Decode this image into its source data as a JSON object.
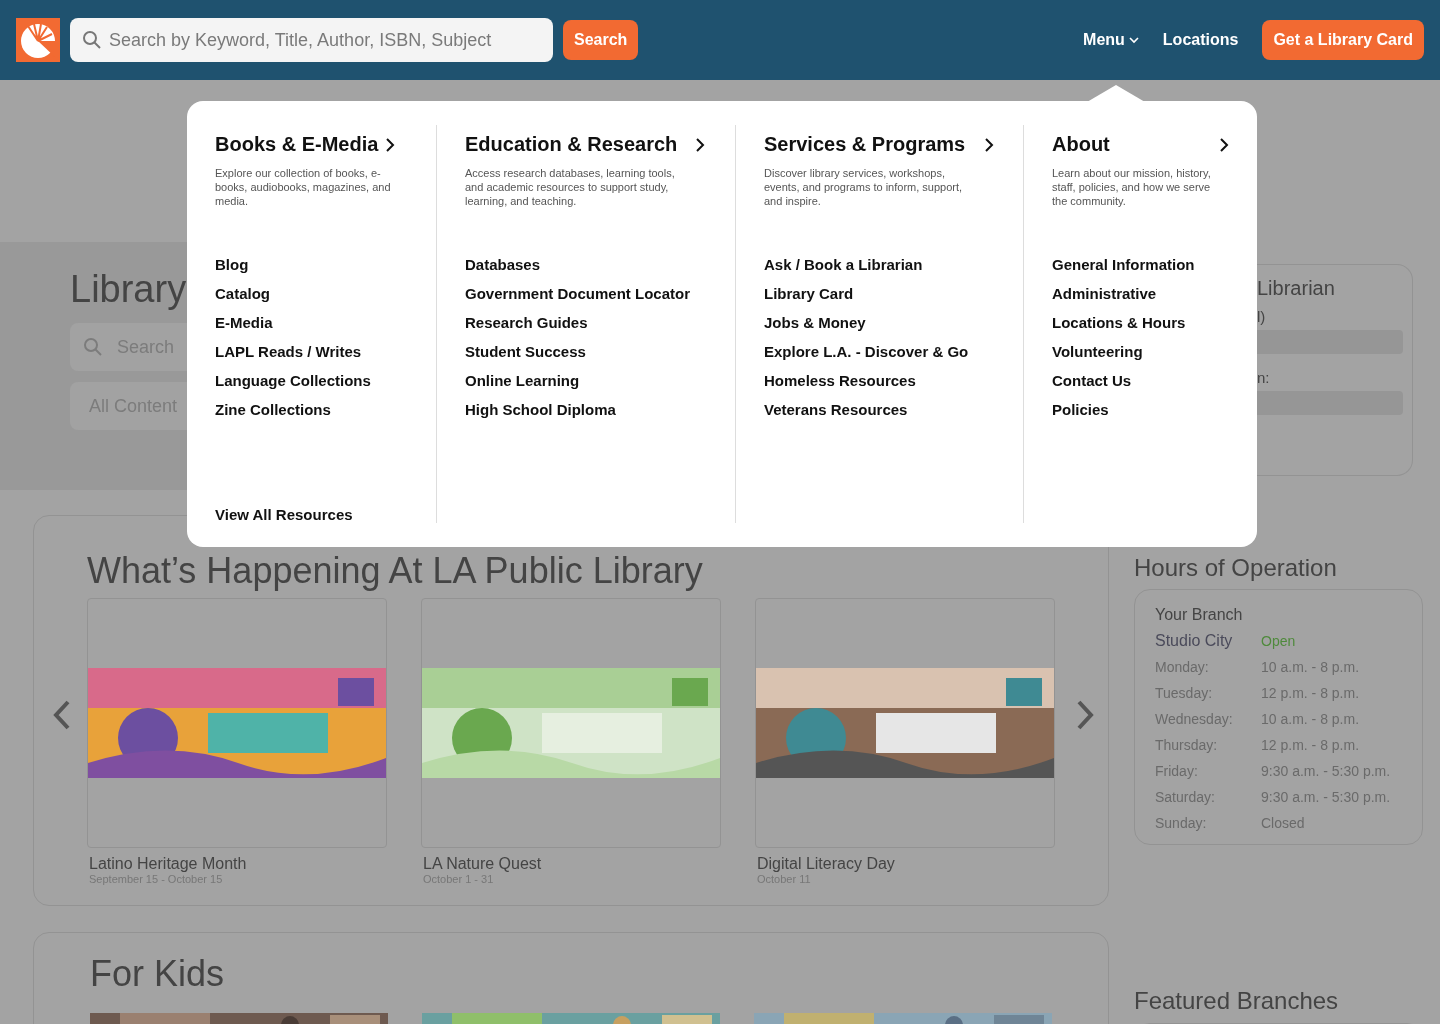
{
  "header": {
    "search": {
      "placeholder": "Search by Keyword, Title, Author, ISBN, Subject"
    },
    "search_button": "Search",
    "nav": [
      {
        "label": "Menu",
        "kind": "dropdown"
      },
      {
        "label": "Locations",
        "kind": "link"
      }
    ],
    "cta": "Get a Library Card"
  },
  "mega_menu": {
    "columns": [
      {
        "title": "Books & E-Media",
        "description": "Explore our collection of books, e-books, audiobooks, magazines, and media.",
        "links": [
          "Blog",
          "Catalog",
          "E-Media",
          "LAPL Reads / Writes",
          "Language Collections",
          "Zine Collections"
        ],
        "footer_link": "View All Resources"
      },
      {
        "title": "Education & Research",
        "description": "Access research databases, learning tools, and academic resources to support study, learning, and teaching.",
        "links": [
          "Databases",
          "Government Document Locator",
          "Research Guides",
          "Student Success",
          "Online Learning",
          "High School Diploma"
        ]
      },
      {
        "title": "Services & Programs",
        "description": "Discover library services, workshops, events, and programs to inform, support, and inspire.",
        "links": [
          "Ask / Book a Librarian",
          "Library Card",
          "Jobs & Money",
          "Explore L.A. - Discover & Go",
          "Homeless Resources",
          "Veterans Resources"
        ]
      },
      {
        "title": "About",
        "description": "Learn about our mission, history, staff, policies, and how we serve the community.",
        "links": [
          "General Information",
          "Administrative",
          "Locations & Hours",
          "Volunteering",
          "Contact Us",
          "Policies"
        ]
      }
    ]
  },
  "hero": {
    "title": "Library",
    "search_placeholder": "Search",
    "filter": "All Content"
  },
  "ask_card": {
    "title": "Librarian",
    "field_1_label": "l)",
    "field_2_label": "n:"
  },
  "events": {
    "title": "What’s Happening At LA Public Library",
    "items": [
      {
        "title": "Latino Heritage Month",
        "date": "September 15 - October 15"
      },
      {
        "title": "LA Nature Quest",
        "date": "October 1 - 31"
      },
      {
        "title": "Digital Literacy Day",
        "date": "October 11"
      }
    ]
  },
  "hours": {
    "title": "Hours of Operation",
    "label": "Your Branch",
    "branch": "Studio City",
    "status": "Open",
    "days": [
      {
        "day": "Monday:",
        "hours": "10 a.m. - 8 p.m."
      },
      {
        "day": "Tuesday:",
        "hours": "12 p.m. - 8 p.m."
      },
      {
        "day": "Wednesday:",
        "hours": "10 a.m. - 8 p.m."
      },
      {
        "day": "Thursday:",
        "hours": "12 p.m. - 8 p.m."
      },
      {
        "day": "Friday:",
        "hours": "9:30 a.m. - 5:30 p.m."
      },
      {
        "day": "Saturday:",
        "hours": "9:30 a.m. - 5:30 p.m."
      },
      {
        "day": "Sunday:",
        "hours": "Closed"
      }
    ]
  },
  "for_kids": {
    "title": "For Kids"
  },
  "featured_branches": {
    "title": "Featured Branches"
  }
}
